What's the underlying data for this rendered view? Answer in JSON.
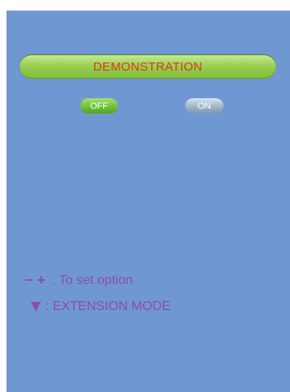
{
  "header": {
    "title": "DEMONSTRATION"
  },
  "options": {
    "off_label": "OFF",
    "on_label": "ON",
    "selected": "OFF"
  },
  "hints": [
    {
      "symbols": "− +",
      "text": ": To set option"
    },
    {
      "symbol": "down-triangle-icon",
      "text": ": EXTENSION MODE"
    }
  ],
  "colors": {
    "background": "#6f98d2",
    "title_text": "#d93a1e",
    "title_bar": "#9ccf55",
    "hint_text": "#8e49b3",
    "off_selected": "#6fc238",
    "on_unselected": "#9fb6cc"
  }
}
